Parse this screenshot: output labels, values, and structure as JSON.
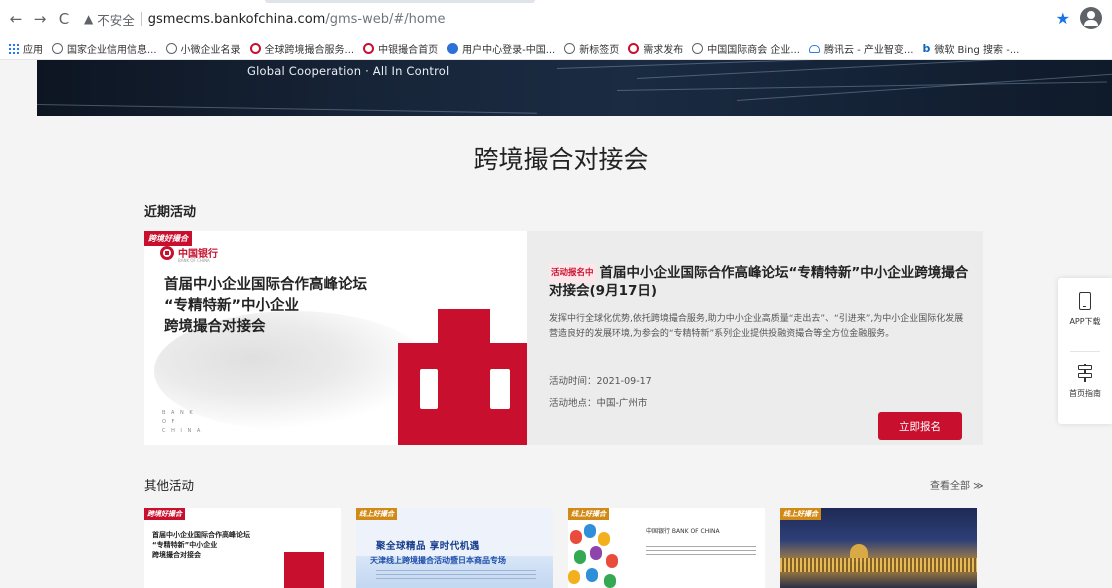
{
  "browser": {
    "insecure_label": "不安全",
    "url_domain": "gsmecms.bankofchina.com",
    "url_path": "/gms-web/#/home",
    "bookmarks": [
      {
        "label": "应用",
        "icon": "apps-grid-icon"
      },
      {
        "label": "国家企业信用信息...",
        "icon": "globe-icon"
      },
      {
        "label": "小微企业名录",
        "icon": "globe-icon"
      },
      {
        "label": "全球跨境撮合服务...",
        "icon": "boc-icon"
      },
      {
        "label": "中银撮合首页",
        "icon": "boc-icon"
      },
      {
        "label": "用户中心登录-中国...",
        "icon": "blue-site-icon"
      },
      {
        "label": "新标签页",
        "icon": "globe-icon"
      },
      {
        "label": "需求发布",
        "icon": "boc-icon"
      },
      {
        "label": "中国国际商会 企业...",
        "icon": "globe-icon"
      },
      {
        "label": "腾讯云 - 产业智变...",
        "icon": "cloud-icon"
      },
      {
        "label": "微软 Bing 搜索 -...",
        "icon": "bing-icon"
      }
    ]
  },
  "banner": {
    "tagline": "Global Cooperation · All In Control"
  },
  "page": {
    "title": "跨境撮合对接会"
  },
  "recent": {
    "section_title": "近期活动",
    "image": {
      "corner_tag": "跨境好撮合",
      "bank_name": "中国银行",
      "bank_sub": "BANK OF CHINA",
      "headline": [
        "首届中小企业国际合作高峰论坛",
        "“专精特新”中小企业",
        "跨境撮合对接会"
      ],
      "bank_vertical": [
        "B A N K",
        "O F",
        "C H I N A"
      ]
    },
    "status": "活动报名中",
    "title": "首届中小企业国际合作高峰论坛“专精特新”中小企业跨境撮合对接会(9月17日)",
    "description": "发挥中行全球化优势,依托跨境撮合服务,助力中小企业高质量“走出去”、“引进来”,为中小企业国际化发展营造良好的发展环境,为参会的“专精特新”系列企业提供投融资撮合等全方位金融服务。",
    "time": "活动时间：2021-09-17",
    "location": "活动地点：中国-广州市",
    "apply_button": "立即报名"
  },
  "others": {
    "section_title": "其他活动",
    "view_all": "查看全部 ≫",
    "cards": [
      {
        "tag": "跨境好撮合",
        "lines": [
          "首届中小企业国际合作高峰论坛",
          "“专精特新”中小企业",
          "跨境撮合对接会"
        ]
      },
      {
        "tag": "线上好撮合",
        "line1": "聚全球精品 享时代机遇",
        "line2": "天津线上跨境撮合活动暨日本商品专场"
      },
      {
        "tag": "线上好撮合",
        "logos": "中国银行 BANK OF CHINA"
      },
      {
        "tag": "线上好撮合"
      }
    ]
  },
  "side_widget": {
    "app_download": "APP下载",
    "home_guide": "首页指南"
  }
}
